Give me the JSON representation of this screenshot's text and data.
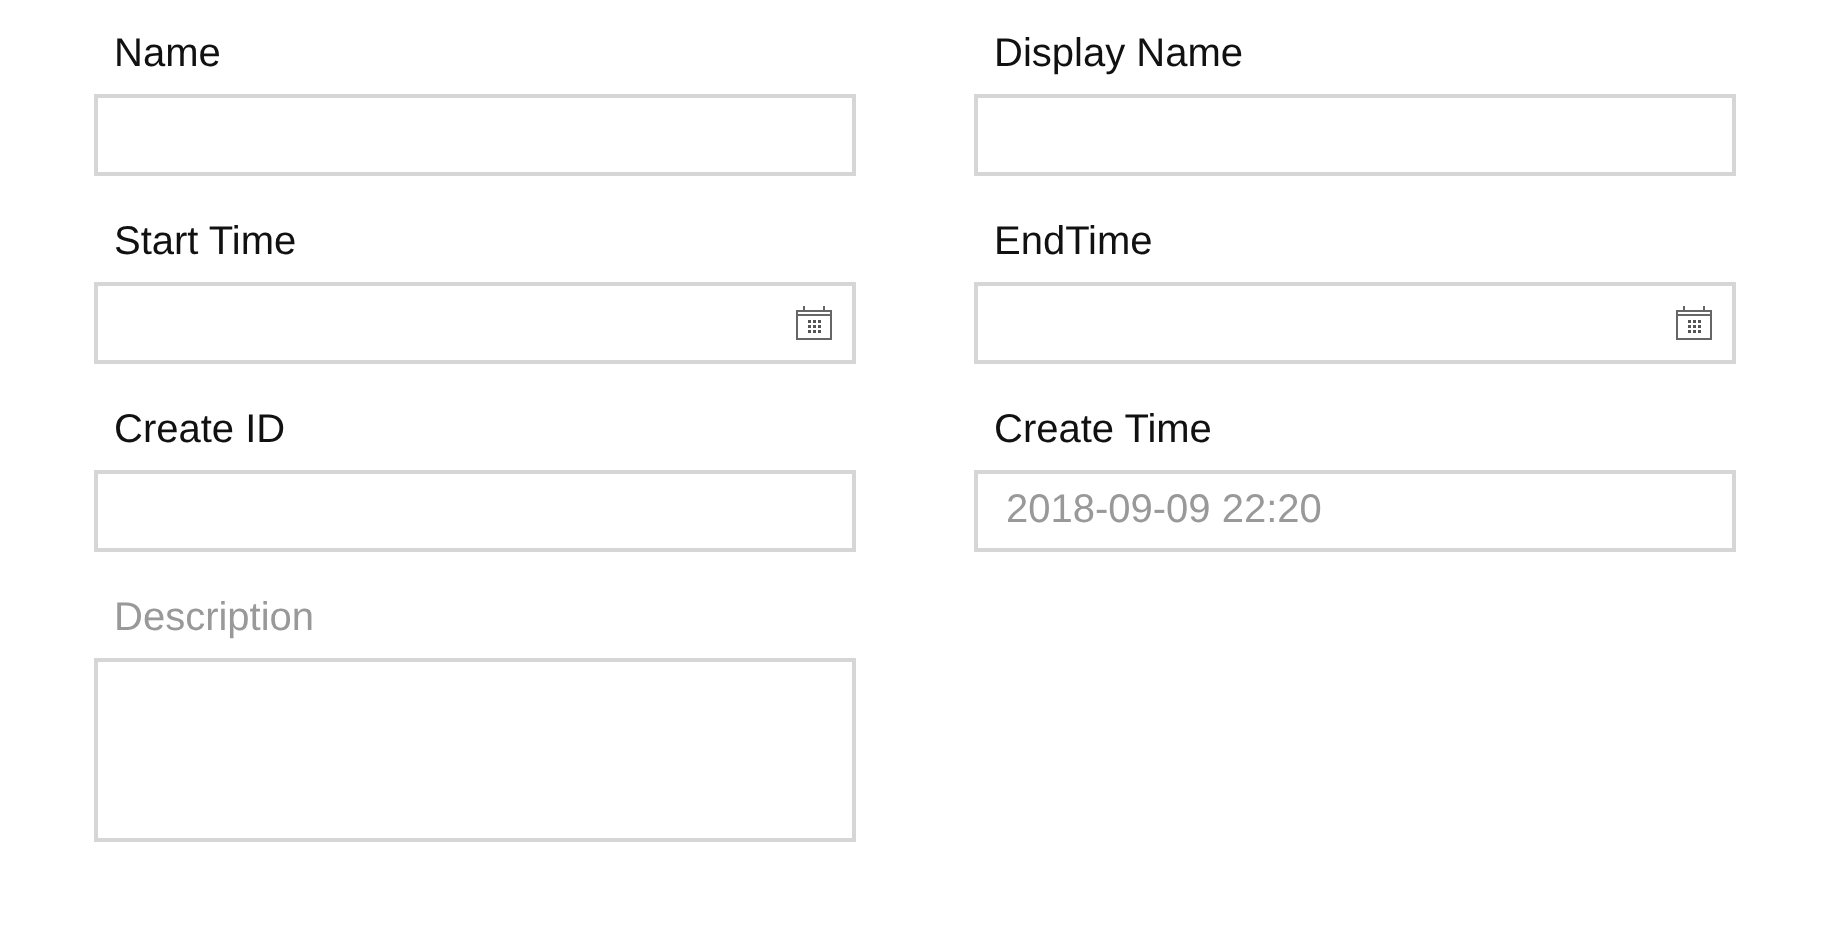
{
  "fields": [
    {
      "label": "Name",
      "label_dimmed": false,
      "kind": "text"
    },
    {
      "label": "Display Name",
      "label_dimmed": false,
      "kind": "text"
    },
    {
      "label": "Start Time",
      "label_dimmed": false,
      "kind": "date"
    },
    {
      "label": "EndTime",
      "label_dimmed": false,
      "kind": "date"
    },
    {
      "label": "Create ID",
      "label_dimmed": false,
      "kind": "text"
    },
    {
      "label": "Create Time",
      "label_dimmed": false,
      "kind": "text",
      "placeholder": "2018-09-09 22:20"
    },
    {
      "label": "Description",
      "label_dimmed": true,
      "kind": "textarea"
    }
  ]
}
